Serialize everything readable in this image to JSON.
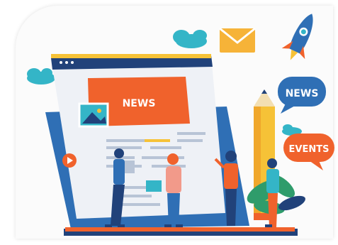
{
  "illustration": {
    "monitor_headline": "NEWS",
    "speech_bubble_news": "NEWS",
    "speech_bubble_events": "EVENTS"
  },
  "palette": {
    "laptop_blue": "#2f6fb5",
    "deep_blue": "#21427a",
    "orange": "#f0622c",
    "yellow": "#f6c237",
    "teal": "#34b5c7",
    "green": "#2f9c6b",
    "screen_bg": "#eef1f6"
  },
  "icons": [
    "rocket-icon",
    "envelope-icon",
    "cloud-icon",
    "pencil-icon",
    "image-icon",
    "play-icon",
    "plant-icon"
  ]
}
